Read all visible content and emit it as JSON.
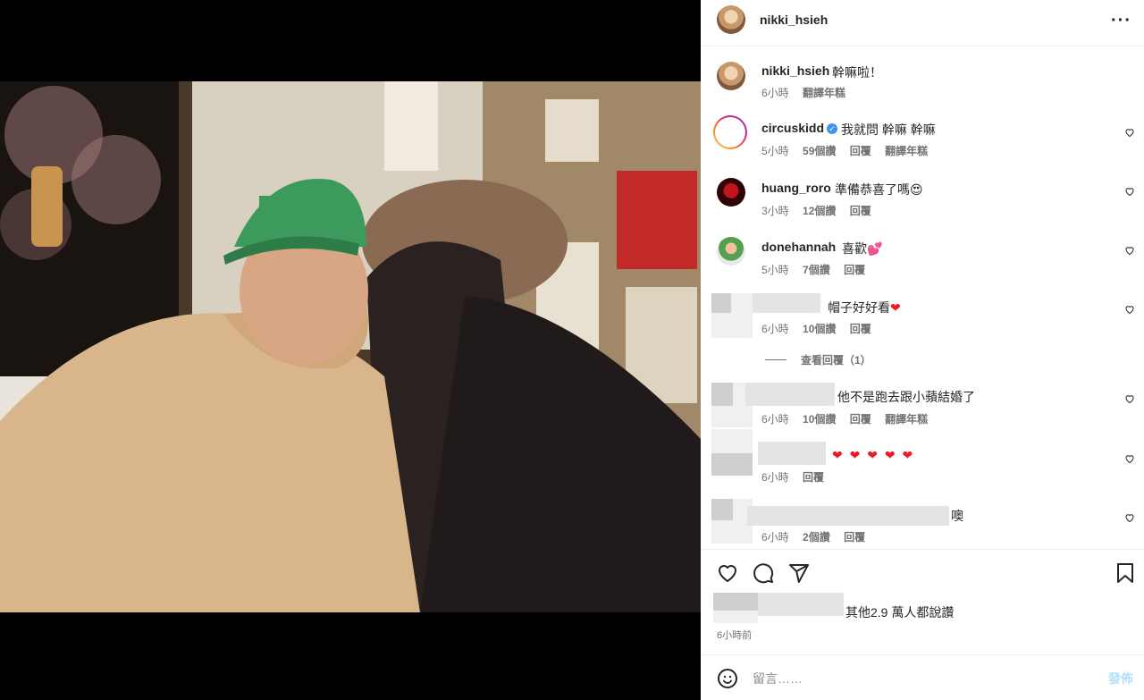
{
  "post": {
    "owner": "nikki_hsieh",
    "caption_user": "nikki_hsieh",
    "caption_text": "幹嘛啦！",
    "caption_time": "6小時",
    "caption_translate": "翻譯年糕"
  },
  "comments": [
    {
      "user": "circuskidd",
      "verified": true,
      "text": "我就問 幹嘛 幹嘛",
      "time": "5小時",
      "likes": "59個讚",
      "reply": "回覆",
      "translate": "翻譯年糕"
    },
    {
      "user": "huang_roro",
      "text": "準備恭喜了嗎😍",
      "time": "3小時",
      "likes": "12個讚",
      "reply": "回覆"
    },
    {
      "user": "donehannah",
      "text": "喜歡💕",
      "time": "5小時",
      "likes": "7個讚",
      "reply": "回覆"
    },
    {
      "user": "",
      "text": "帽子好好看",
      "text_emoji": "❤",
      "time": "6小時",
      "likes": "10個讚",
      "reply": "回覆",
      "view_replies": "查看回覆（1）"
    },
    {
      "user": "",
      "text": "他不是跑去跟小蘋結婚了",
      "time": "6小時",
      "likes": "10個讚",
      "reply": "回覆",
      "translate": "翻譯年糕"
    },
    {
      "user": "",
      "text": "❤ ❤ ❤ ❤ ❤",
      "time": "6小時",
      "reply": "回覆"
    },
    {
      "user": "",
      "text": "噢",
      "time": "6小時",
      "likes": "2個讚",
      "reply": "回覆"
    }
  ],
  "actions": {
    "likes_text": "其他2.9 萬人都說讚",
    "time_ago": "6小時前"
  },
  "comment_box": {
    "placeholder": "留言……",
    "post_label": "發佈"
  },
  "colors": {
    "accent": "#0095f6",
    "heart": "#ed1c24",
    "verified": "#3897f0"
  },
  "icons": [
    "more-icon",
    "heart-icon",
    "comment-icon",
    "share-icon",
    "bookmark-icon",
    "emoji-icon"
  ]
}
